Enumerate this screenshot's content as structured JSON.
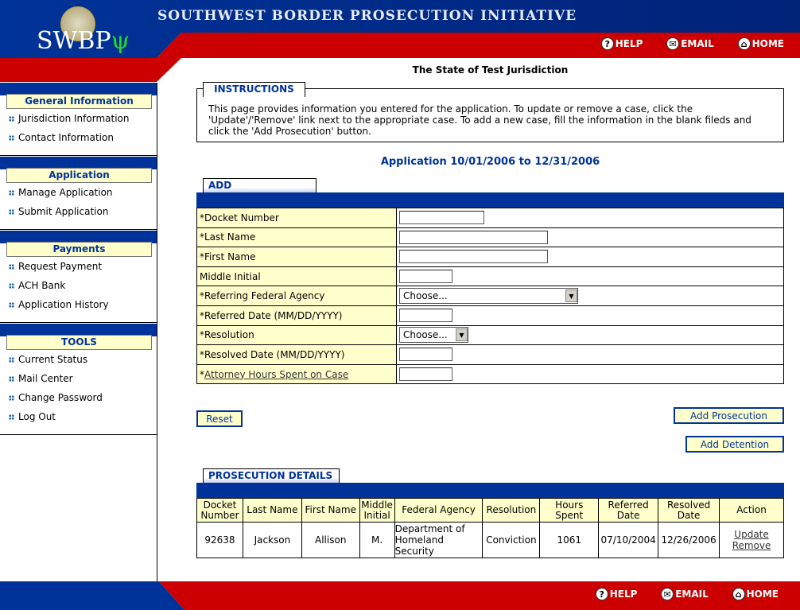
{
  "header": {
    "title": "SOUTHWEST BORDER PROSECUTION INITIATIVE",
    "logo": "SWBP",
    "nav": [
      {
        "label": "HELP",
        "icon": "help-icon"
      },
      {
        "label": "EMAIL",
        "icon": "email-icon"
      },
      {
        "label": "HOME",
        "icon": "home-icon"
      }
    ]
  },
  "colors": {
    "blue": "#003399",
    "red": "#cc0000",
    "yellow": "#ffffcc"
  },
  "sidebar": {
    "sections": [
      {
        "title": "General Information",
        "items": [
          "Jurisdiction Information",
          "Contact Information"
        ]
      },
      {
        "title": "Application",
        "items": [
          "Manage Application",
          "Submit Application"
        ]
      },
      {
        "title": "Payments",
        "items": [
          "Request Payment",
          "ACH Bank",
          "Application History"
        ]
      },
      {
        "title": "TOOLS",
        "items": [
          "Current Status",
          "Mail Center",
          "Change Password",
          "Log Out"
        ]
      }
    ]
  },
  "main": {
    "jurisdiction": "The State of Test Jurisdiction",
    "instructions": {
      "title": "INSTRUCTIONS",
      "text": "This page provides information you entered for the application.  To update or remove a case, click the 'Update'/'Remove' link next to the appropriate case.  To add a new case, fill the information in the blank fileds and click the 'Add Prosecution' button."
    },
    "application_period": "Application 10/01/2006 to 12/31/2006",
    "add": {
      "title": "ADD PROSECUTION",
      "fields": [
        {
          "label": "*Docket Number",
          "value": ""
        },
        {
          "label": "*Last Name",
          "value": ""
        },
        {
          "label": "*First Name",
          "value": ""
        },
        {
          "label": "Middle Initial",
          "value": ""
        },
        {
          "label": "*Referring Federal Agency",
          "value": "Choose..."
        },
        {
          "label": "*Referred Date (MM/DD/YYYY)",
          "value": ""
        },
        {
          "label": "*Resolution",
          "value": "Choose..."
        },
        {
          "label": "*Resolved Date (MM/DD/YYYY)",
          "value": ""
        },
        {
          "label": "*",
          "link": "Attorney Hours Spent on Case",
          "value": ""
        }
      ]
    },
    "buttons": {
      "reset": "Reset",
      "add_prosecution": "Add Prosecution",
      "add_detention": "Add Detention"
    },
    "details": {
      "title": "PROSECUTION DETAILS",
      "headers": [
        "Docket Number",
        "Last Name",
        "First Name",
        "Middle Initial",
        "Federal Agency",
        "Resolution",
        "Hours Spent",
        "Referred Date",
        "Resolved Date",
        "Action"
      ],
      "rows": [
        {
          "docket": "92638",
          "last": "Jackson",
          "first": "Allison",
          "mi": "M.",
          "agency": "Department of Homeland Security",
          "resolution": "Conviction",
          "hours": "1061",
          "referred": "07/10/2004",
          "resolved": "12/26/2006",
          "update": "Update",
          "remove": "Remove"
        }
      ]
    }
  }
}
